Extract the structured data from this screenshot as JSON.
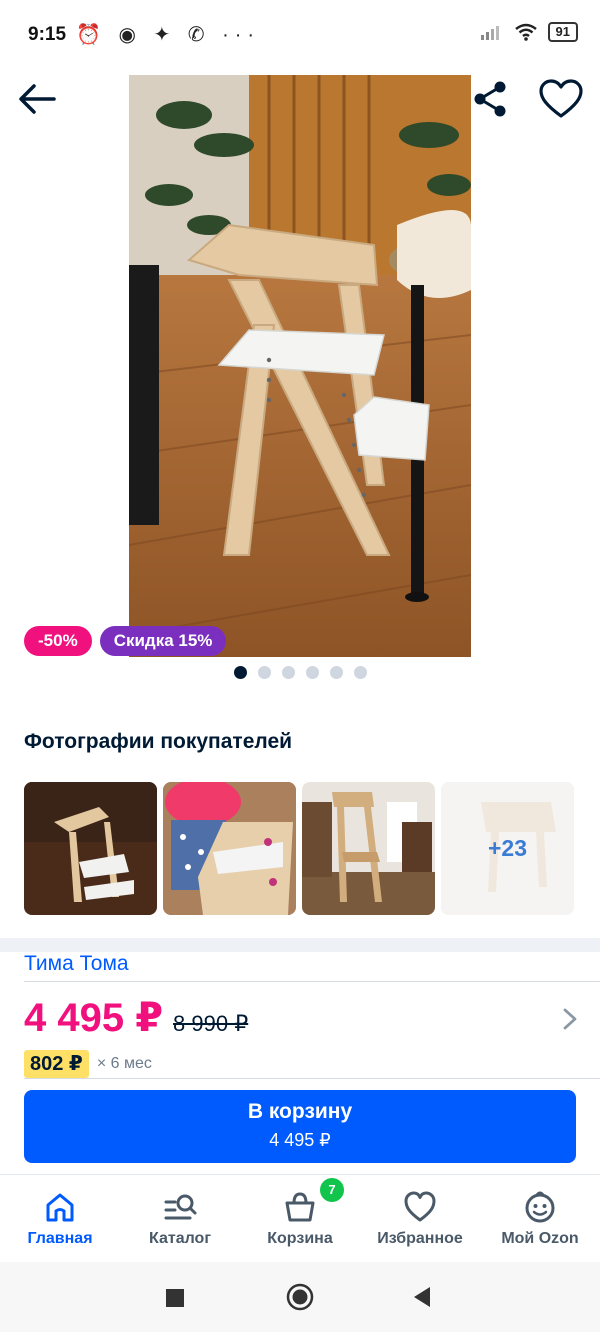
{
  "status_bar": {
    "time": "9:15",
    "battery": "91"
  },
  "product": {
    "badges": {
      "discount": "-50%",
      "sale": "Скидка 15%"
    },
    "gallery_dots_total": 6,
    "gallery_dots_active_index": 0
  },
  "buyer_photos": {
    "title": "Фотографии покупателей",
    "more_count": "+23"
  },
  "seller": {
    "name": "Тима Тома"
  },
  "price": {
    "current": "4 495 ₽",
    "old": "8 990 ₽"
  },
  "installment": {
    "amount": "802 ₽",
    "term": "× 6 мес"
  },
  "cart_button": {
    "label": "В корзину",
    "price": "4 495 ₽"
  },
  "bottom_nav": {
    "home": "Главная",
    "catalog": "Каталог",
    "cart": "Корзина",
    "favorites": "Избранное",
    "profile": "Мой Ozon",
    "cart_count": "7"
  },
  "colors": {
    "accent_blue": "#005bff",
    "price_pink": "#f1117e",
    "badge_purple": "#7b2fbe",
    "cart_badge_green": "#10c44c"
  }
}
